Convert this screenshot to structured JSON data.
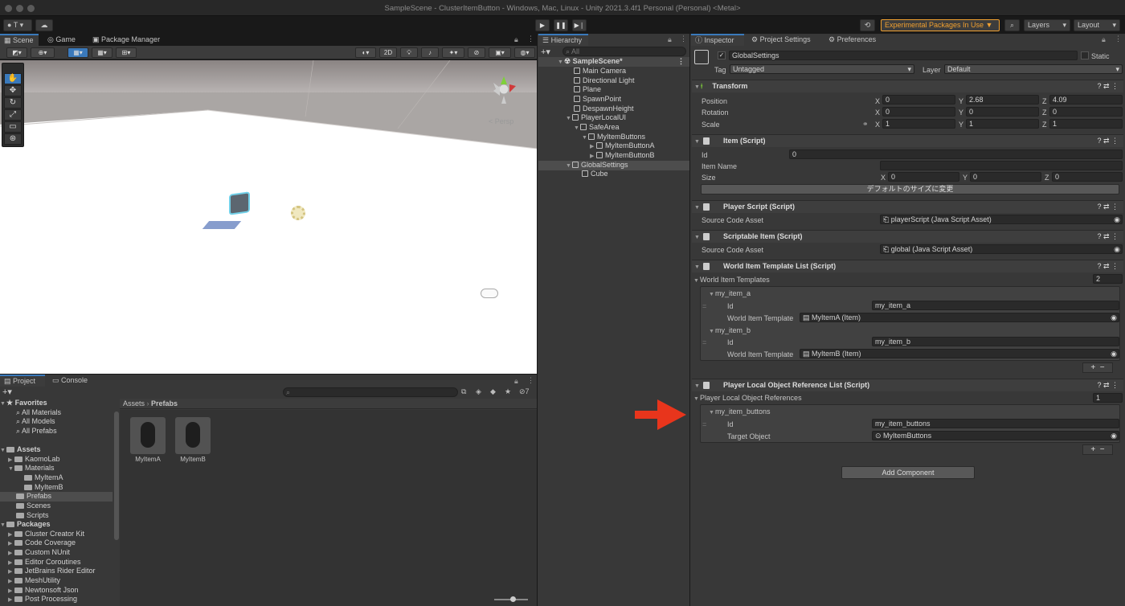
{
  "window": {
    "title": "SampleScene - ClusterItemButton - Windows, Mac, Linux - Unity 2021.3.4f1 Personal (Personal) <Metal>"
  },
  "toolbar": {
    "account": "T",
    "experimental": "Experimental Packages In Use ▼",
    "layers": "Layers",
    "layout": "Layout"
  },
  "scene": {
    "tabs": [
      "Scene",
      "Game",
      "Package Manager"
    ],
    "mode_2d": "2D",
    "persp": "< Persp"
  },
  "hierarchy": {
    "tab": "Hierarchy",
    "search_placeholder": "All",
    "items": [
      {
        "label": "SampleScene*"
      },
      {
        "label": "Main Camera"
      },
      {
        "label": "Directional Light"
      },
      {
        "label": "Plane"
      },
      {
        "label": "SpawnPoint"
      },
      {
        "label": "DespawnHeight"
      },
      {
        "label": "PlayerLocalUI"
      },
      {
        "label": "SafeArea"
      },
      {
        "label": "MyItemButtons"
      },
      {
        "label": "MyItemButtonA"
      },
      {
        "label": "MyItemButtonB"
      },
      {
        "label": "GlobalSettings"
      },
      {
        "label": "Cube"
      }
    ]
  },
  "project": {
    "tabs": [
      "Project",
      "Console"
    ],
    "breadcrumb": [
      "Assets",
      "Prefabs"
    ],
    "count": "7",
    "tree": [
      {
        "label": "Favorites"
      },
      {
        "label": "All Materials"
      },
      {
        "label": "All Models"
      },
      {
        "label": "All Prefabs"
      },
      {
        "label": "Assets"
      },
      {
        "label": "KaomoLab"
      },
      {
        "label": "Materials"
      },
      {
        "label": "MyItemA"
      },
      {
        "label": "MyItemB"
      },
      {
        "label": "Prefabs"
      },
      {
        "label": "Scenes"
      },
      {
        "label": "Scripts"
      },
      {
        "label": "Packages"
      },
      {
        "label": "Cluster Creator Kit"
      },
      {
        "label": "Code Coverage"
      },
      {
        "label": "Custom NUnit"
      },
      {
        "label": "Editor Coroutines"
      },
      {
        "label": "JetBrains Rider Editor"
      },
      {
        "label": "MeshUtility"
      },
      {
        "label": "Newtonsoft Json"
      },
      {
        "label": "Post Processing"
      }
    ],
    "assets": [
      "MyItemA",
      "MyItemB"
    ]
  },
  "inspector": {
    "tabs": [
      "Inspector",
      "Project Settings",
      "Preferences"
    ],
    "object_name": "GlobalSettings",
    "static": "Static",
    "tag_label": "Tag",
    "tag": "Untagged",
    "layer_label": "Layer",
    "layer": "Default",
    "transform": {
      "title": "Transform",
      "position": "Position",
      "rotation": "Rotation",
      "scale": "Scale",
      "pos": [
        "0",
        "2.68",
        "4.09"
      ],
      "rot": [
        "0",
        "0",
        "0"
      ],
      "scl": [
        "1",
        "1",
        "1"
      ]
    },
    "item": {
      "title": "Item (Script)",
      "id_label": "Id",
      "id": "0",
      "name_label": "Item Name",
      "name": "",
      "size_label": "Size",
      "size": [
        "0",
        "0",
        "0"
      ],
      "button": "デフォルトのサイズに変更"
    },
    "player_script": {
      "title": "Player Script (Script)",
      "label": "Source Code Asset",
      "value": "playerScript (Java Script Asset)"
    },
    "scriptable_item": {
      "title": "Scriptable Item (Script)",
      "label": "Source Code Asset",
      "value": "global (Java Script Asset)"
    },
    "world_templates": {
      "title": "World Item Template List (Script)",
      "list_label": "World Item Templates",
      "count": "2",
      "entries": [
        {
          "header": "my_item_a",
          "id_label": "Id",
          "id": "my_item_a",
          "tpl_label": "World Item Template",
          "tpl": "MyItemA (Item)"
        },
        {
          "header": "my_item_b",
          "id_label": "Id",
          "id": "my_item_b",
          "tpl_label": "World Item Template",
          "tpl": "MyItemB (Item)"
        }
      ]
    },
    "local_refs": {
      "title": "Player Local Object Reference List (Script)",
      "list_label": "Player Local Object References",
      "count": "1",
      "entry": {
        "header": "my_item_buttons",
        "id_label": "Id",
        "id": "my_item_buttons",
        "target_label": "Target Object",
        "target": "MyItemButtons"
      }
    },
    "add_component": "Add Component"
  },
  "axes": {
    "x": "X",
    "y": "Y",
    "z": "Z"
  },
  "colors": {
    "accent": "#3a79bb",
    "arrow": "#e8351c",
    "experimental": "#f0a030"
  }
}
